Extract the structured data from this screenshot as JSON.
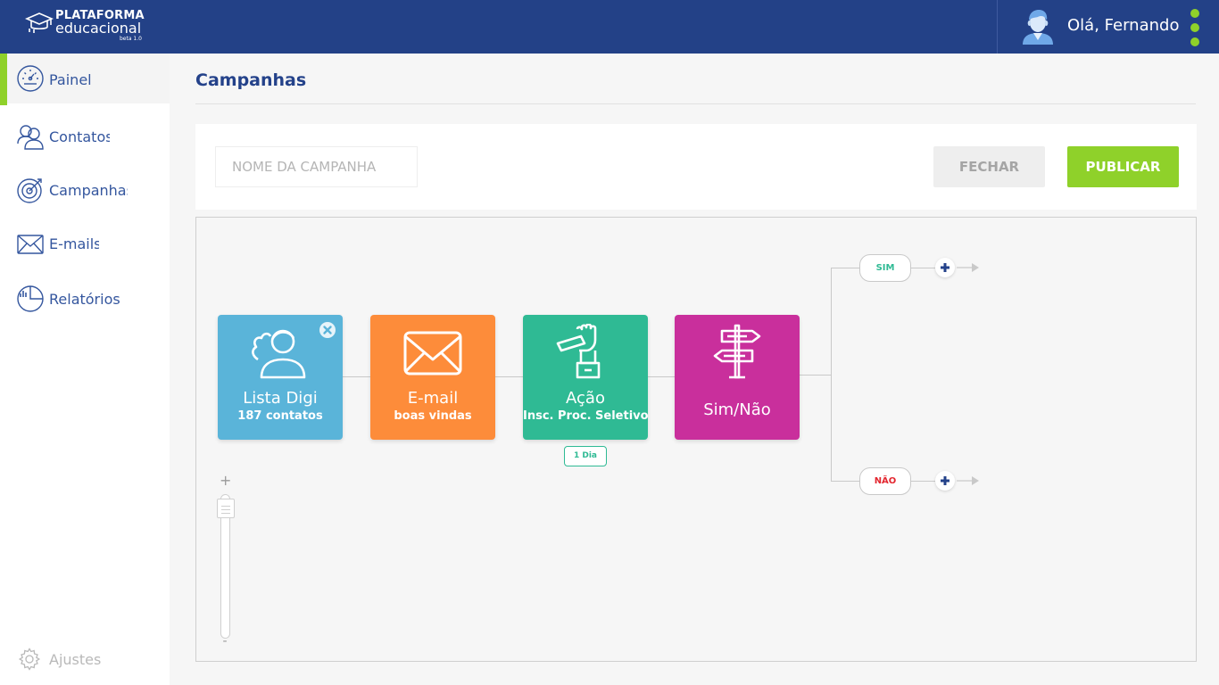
{
  "header": {
    "logo_line1": "PLATAFORMA",
    "logo_line2": "educacional",
    "logo_version": "beta 1.0",
    "greeting": "Olá, Fernando"
  },
  "sidebar": {
    "items": [
      {
        "label": "Painel",
        "icon": "gauge-icon",
        "active": true
      },
      {
        "label": "Contatos",
        "icon": "contacts-icon"
      },
      {
        "label": "Campanhas",
        "icon": "target-icon"
      },
      {
        "label": "E-mails",
        "icon": "envelope-icon"
      },
      {
        "label": "Relatórios",
        "icon": "report-chart-icon"
      }
    ],
    "settings_label": "Ajustes"
  },
  "page": {
    "title": "Campanhas"
  },
  "toolbar": {
    "campaign_name_placeholder": "NOME DA CAMPANHA",
    "campaign_name_value": "",
    "close_label": "FECHAR",
    "publish_label": "PUBLICAR"
  },
  "flow": {
    "nodes": [
      {
        "title": "Lista Digi",
        "subtitle": "187 contatos",
        "icon": "user-list-icon"
      },
      {
        "title": "E-mail",
        "subtitle": "boas vindas",
        "icon": "envelope-icon"
      },
      {
        "title": "Ação",
        "subtitle": "Insc. Proc. Seletivo",
        "icon": "hand-pen-icon"
      },
      {
        "title": "Sim/Não",
        "subtitle": "",
        "icon": "signpost-icon"
      }
    ],
    "delay_label": "1 Dia",
    "branch_yes": "SIM",
    "branch_no": "NÃO"
  },
  "zoom": {
    "plus": "+",
    "minus": "-"
  },
  "colors": {
    "header_bg": "#234187",
    "accent_green": "#8fd12a",
    "node_list": "#5ab4d9",
    "node_email": "#fd8c3a",
    "node_action": "#2fba94",
    "node_branch": "#c92f9c",
    "no_red": "#e3262f"
  }
}
